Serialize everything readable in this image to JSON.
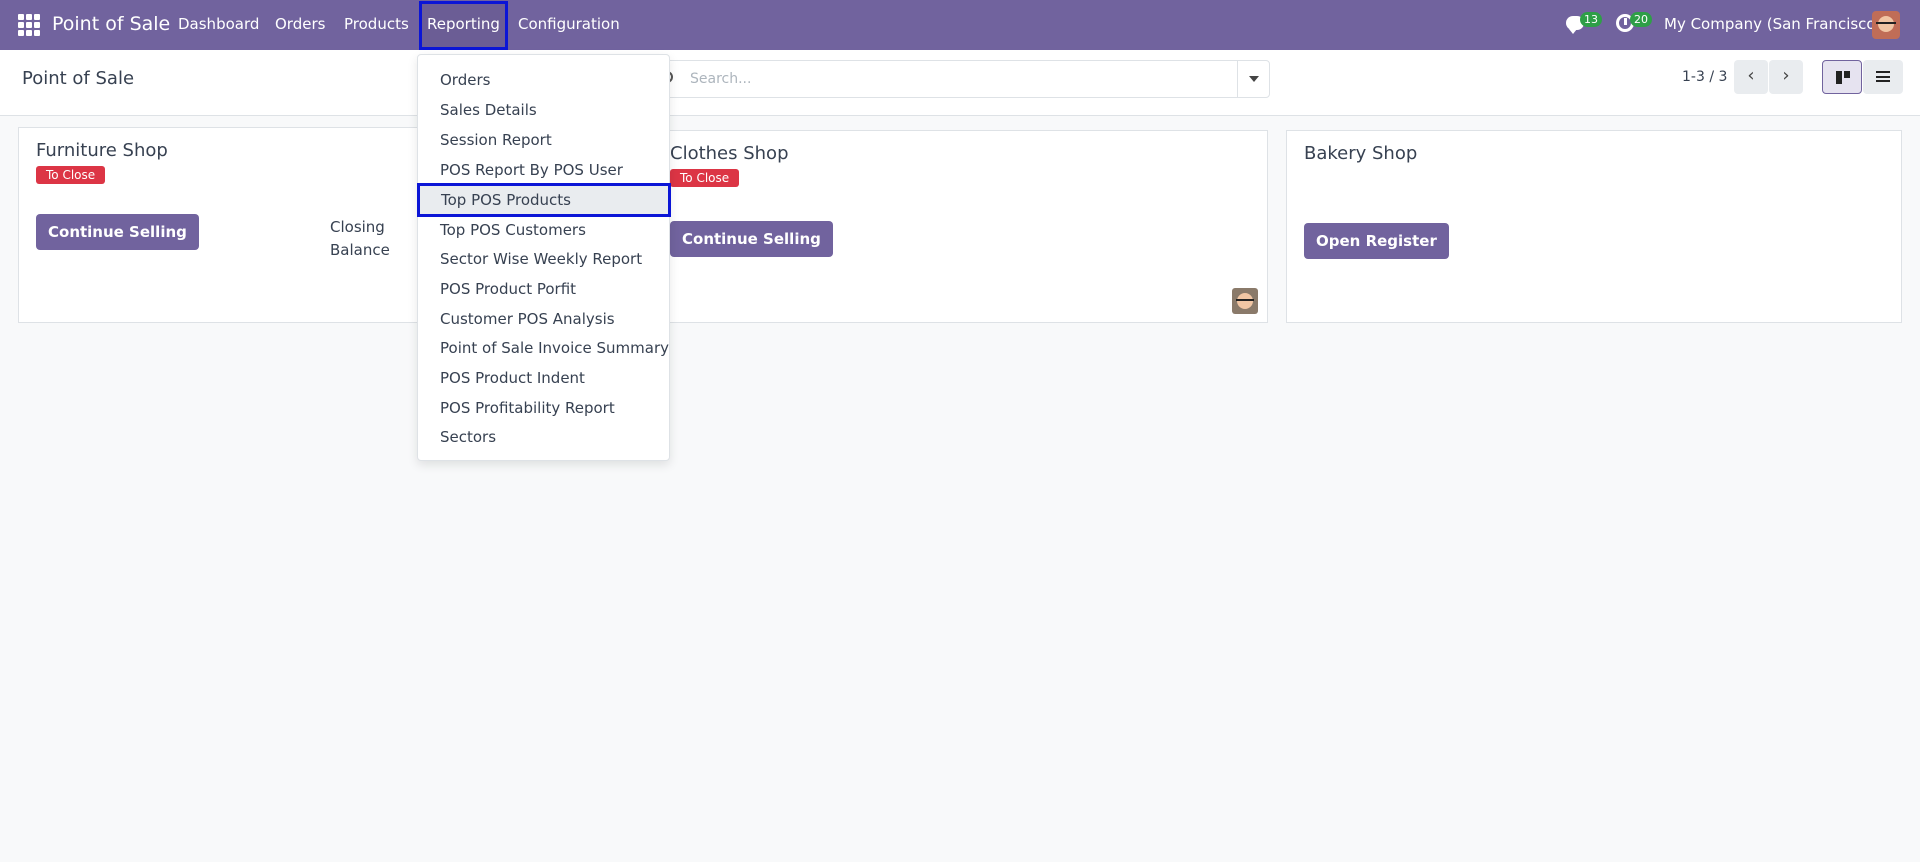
{
  "navbar": {
    "brand": "Point of Sale",
    "menu": [
      "Dashboard",
      "Orders",
      "Products",
      "Reporting",
      "Configuration"
    ],
    "messages_count": "13",
    "activities_count": "20",
    "company": "My Company (San Francisco)"
  },
  "control_panel": {
    "title": "Point of Sale",
    "search_placeholder": "Search...",
    "pager": "1-3 / 3"
  },
  "reporting_menu": {
    "items": [
      "Orders",
      "Sales Details",
      "Session Report",
      "POS Report By POS User",
      "Top POS Products",
      "Top POS Customers",
      "Sector Wise Weekly Report",
      "POS Product Porfit",
      "Customer POS Analysis",
      "Point of Sale Invoice Summary",
      "POS Product Indent",
      "POS Profitability Report",
      "Sectors"
    ],
    "highlighted": "Top POS Products"
  },
  "cards": [
    {
      "name": "Furniture Shop",
      "status": "To Close",
      "button": "Continue Selling",
      "closing_label_1": "Closing",
      "closing_label_2": "Balance"
    },
    {
      "name": "Clothes Shop",
      "status": "To Close",
      "button": "Continue Selling"
    },
    {
      "name": "Bakery Shop",
      "button": "Open Register"
    }
  ],
  "colors": {
    "brand": "#71639e",
    "badge": "#2e9f47",
    "status_red": "#dc3545",
    "highlight": "#0b15d6"
  }
}
